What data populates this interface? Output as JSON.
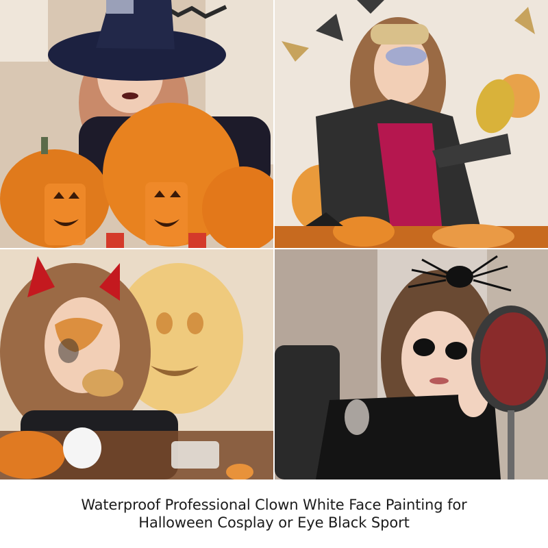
{
  "caption": {
    "line1": "Waterproof Professional Clown White Face Painting for",
    "line2": "Halloween Cosplay or Eye Black Sport"
  },
  "colors": {
    "pumpkin": "#e8821f",
    "witch_hat": "#1c2140",
    "dress_black": "#2b2b2b",
    "dress_magenta": "#b5174f",
    "devil_horns": "#c4191f",
    "mirror_gold": "#d9b23a"
  }
}
